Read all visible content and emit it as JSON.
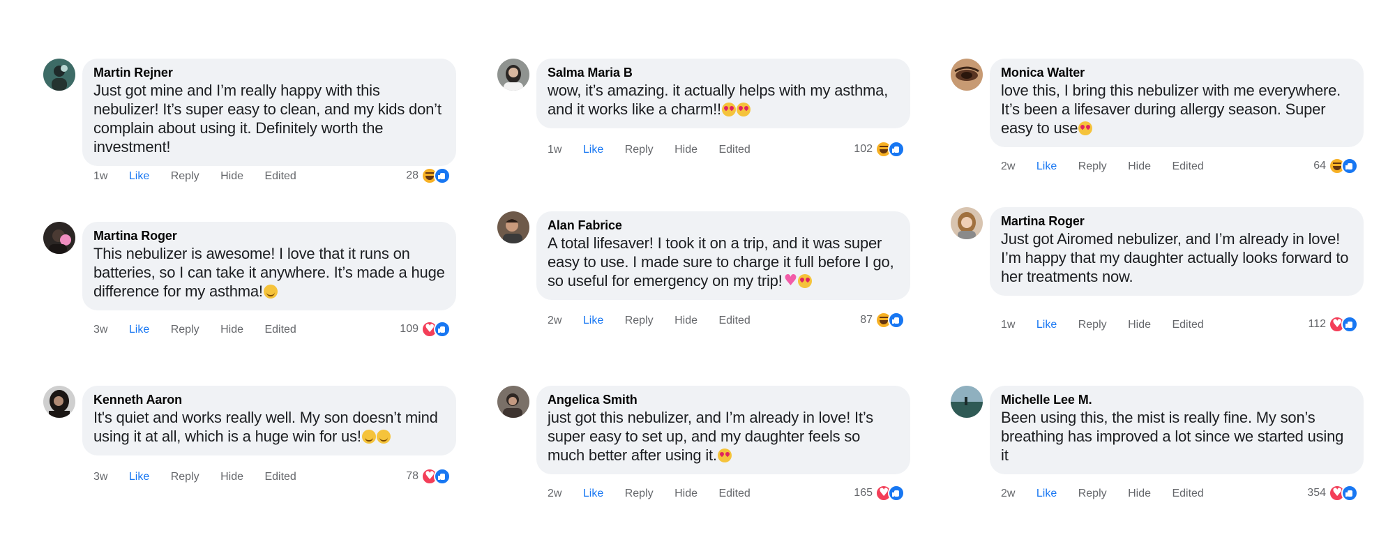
{
  "actions": {
    "like": "Like",
    "reply": "Reply",
    "hide": "Hide",
    "edited": "Edited"
  },
  "colors": {
    "bubble": "#f0f2f5",
    "like_link": "#1877f2",
    "meta_text": "#65676b",
    "like_reaction": "#1877f2",
    "love_reaction": "#f33e58",
    "haha_reaction": "#f7b125"
  },
  "comments": [
    {
      "author": "Martin Rejner",
      "text": "Just got mine and I’m really happy with this nebulizer! It’s super easy to clean, and my kids don’t complain about using it. Definitely worth the investment!",
      "text_emoji": [],
      "time": "1w",
      "count": "28",
      "reactions": [
        "haha-icon",
        "like-icon"
      ],
      "avatar": "avatar-photo"
    },
    {
      "author": "Salma Maria B",
      "text": "wow, it’s amazing. it actually helps with my asthma, and it works like a charm!!",
      "text_emoji": [
        "heart-eyes-emoji",
        "heart-eyes-emoji"
      ],
      "time": "1w",
      "count": "102",
      "reactions": [
        "haha-icon",
        "like-icon"
      ],
      "avatar": "avatar-photo"
    },
    {
      "author": "Monica Walter",
      "text": "love this, I bring this nebulizer with me everywhere. It’s been a lifesaver during allergy season. Super easy to use",
      "text_emoji": [
        "heart-eyes-emoji"
      ],
      "time": "2w",
      "count": "64",
      "reactions": [
        "haha-icon",
        "like-icon"
      ],
      "avatar": "avatar-photo"
    },
    {
      "author": "Martina Roger",
      "text": "This nebulizer is awesome! I love that it runs on batteries, so I can take it anywhere. It’s made a huge difference for my asthma!",
      "text_emoji": [
        "smile-emoji"
      ],
      "time": "3w",
      "count": "109",
      "reactions": [
        "love-icon",
        "like-icon"
      ],
      "avatar": "avatar-photo"
    },
    {
      "author": "Alan Fabrice",
      "text": "A total lifesaver! I took it on a trip, and it was super easy to use. I made sure to charge it full before I go, so useful for emergency on my trip!",
      "text_emoji": [
        "pink-heart-emoji",
        "heart-eyes-emoji"
      ],
      "time": "2w",
      "count": "87",
      "reactions": [
        "haha-icon",
        "like-icon"
      ],
      "avatar": "avatar-photo"
    },
    {
      "author": "Martina Roger",
      "text": "Just got Airomed nebulizer, and I’m already in love! I’m happy that my daughter actually looks forward to her treatments now.",
      "text_emoji": [],
      "time": "1w",
      "count": "112",
      "reactions": [
        "love-icon",
        "like-icon"
      ],
      "avatar": "avatar-photo"
    },
    {
      "author": "Kenneth Aaron",
      "text": "It's quiet and works really well. My son doesn’t mind using it at all, which is a huge win for us!",
      "text_emoji": [
        "smile-emoji",
        "smile-emoji"
      ],
      "time": "3w",
      "count": "78",
      "reactions": [
        "love-icon",
        "like-icon"
      ],
      "avatar": "avatar-photo"
    },
    {
      "author": "Angelica Smith",
      "text": "just got this nebulizer, and I’m already in love! It’s super easy to set up, and my daughter feels so much better after using it.",
      "text_emoji": [
        "heart-eyes-emoji"
      ],
      "time": "2w",
      "count": "165",
      "reactions": [
        "love-icon",
        "like-icon"
      ],
      "avatar": "avatar-photo"
    },
    {
      "author": "Michelle Lee M.",
      "text": "Been using this, the mist is really fine. My son’s breathing has improved a lot since we started using it",
      "text_emoji": [],
      "time": "2w",
      "count": "354",
      "reactions": [
        "love-icon",
        "like-icon"
      ],
      "avatar": "avatar-photo"
    }
  ]
}
